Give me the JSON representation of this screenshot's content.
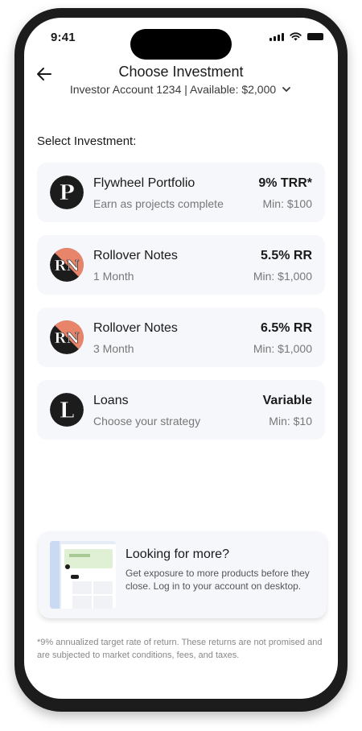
{
  "status_bar": {
    "time": "9:41"
  },
  "header": {
    "title": "Choose Investment",
    "account_selector": "Investor Account 1234 | Available: $2,000"
  },
  "section_label": "Select Investment:",
  "investments": [
    {
      "name": "Flywheel Portfolio",
      "description": "Earn as projects complete",
      "rate": "9% TRR*",
      "min": "Min: $100",
      "logo_letter": "P",
      "logo_color": "#7fb069"
    },
    {
      "name": "Rollover Notes",
      "description": "1 Month",
      "rate": "5.5% RR",
      "min": "Min: $1,000",
      "logo_letter": "RN",
      "logo_color": "#e8846a"
    },
    {
      "name": "Rollover Notes",
      "description": "3 Month",
      "rate": "6.5% RR",
      "min": "Min: $1,000",
      "logo_letter": "RN",
      "logo_color": "#e8846a"
    },
    {
      "name": "Loans",
      "description": "Choose your strategy",
      "rate": "Variable",
      "min": "Min: $10",
      "logo_letter": "L",
      "logo_color": "#b7cef0"
    }
  ],
  "promo": {
    "title": "Looking for more?",
    "text": "Get exposure to more products before they close. Log in to your account on desktop."
  },
  "footnote": "*9% annualized target rate of return. These returns are not promised and are subjected to market conditions, fees, and taxes.",
  "icons": {
    "back": "arrow-left-icon",
    "dropdown": "chevron-down-icon",
    "signal": "cellular-signal-icon",
    "wifi": "wifi-icon",
    "battery": "battery-icon"
  }
}
